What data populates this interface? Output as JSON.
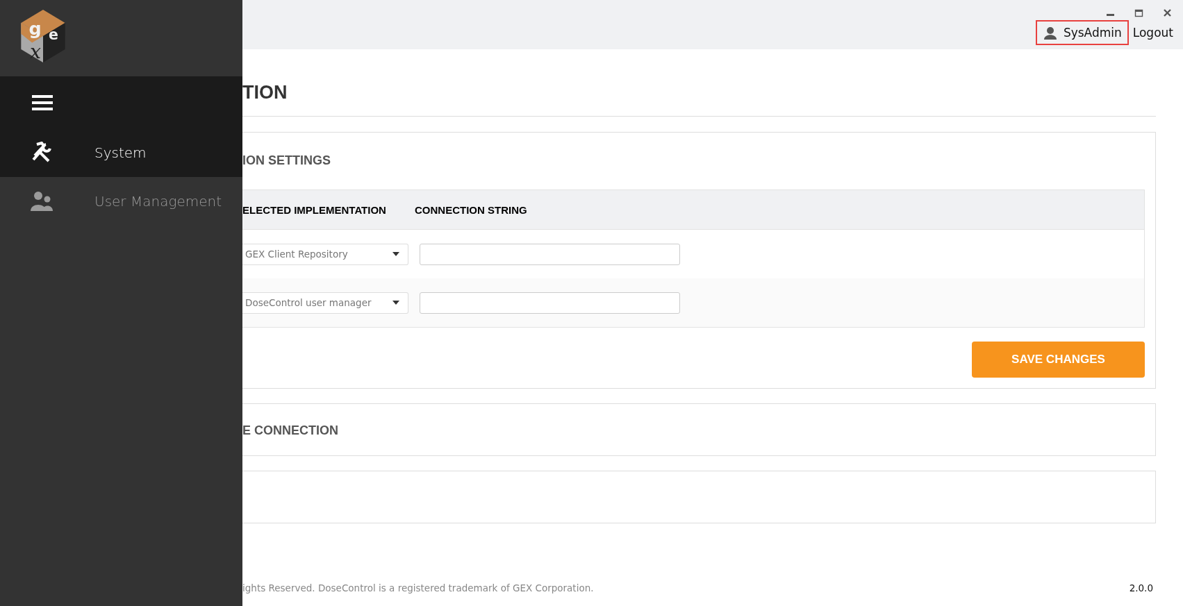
{
  "logo": {
    "top": "g",
    "side": "e",
    "front": "x"
  },
  "sidebar": {
    "items": [
      {
        "label": "System",
        "kind": "tools",
        "selected": true
      },
      {
        "label": "User Management",
        "kind": "users",
        "selected": false
      }
    ]
  },
  "header": {
    "user": "SysAdmin",
    "user_highlighted": true,
    "logout": "Logout"
  },
  "page": {
    "title": "TION",
    "settings": {
      "title": "ION SETTINGS",
      "columns": [
        "ELECTED IMPLEMENTATION",
        "CONNECTION STRING"
      ],
      "rows": [
        {
          "implementation": "GEX Client Repository"
        },
        {
          "implementation": "DoseControl user manager"
        }
      ],
      "button": "SAVE CHANGES"
    },
    "connection": {
      "title": "E CONNECTION"
    }
  },
  "footer": {
    "copyright": "ights Reserved. DoseControl is a registered trademark of GEX Corporation.",
    "version": "2.0.0"
  }
}
